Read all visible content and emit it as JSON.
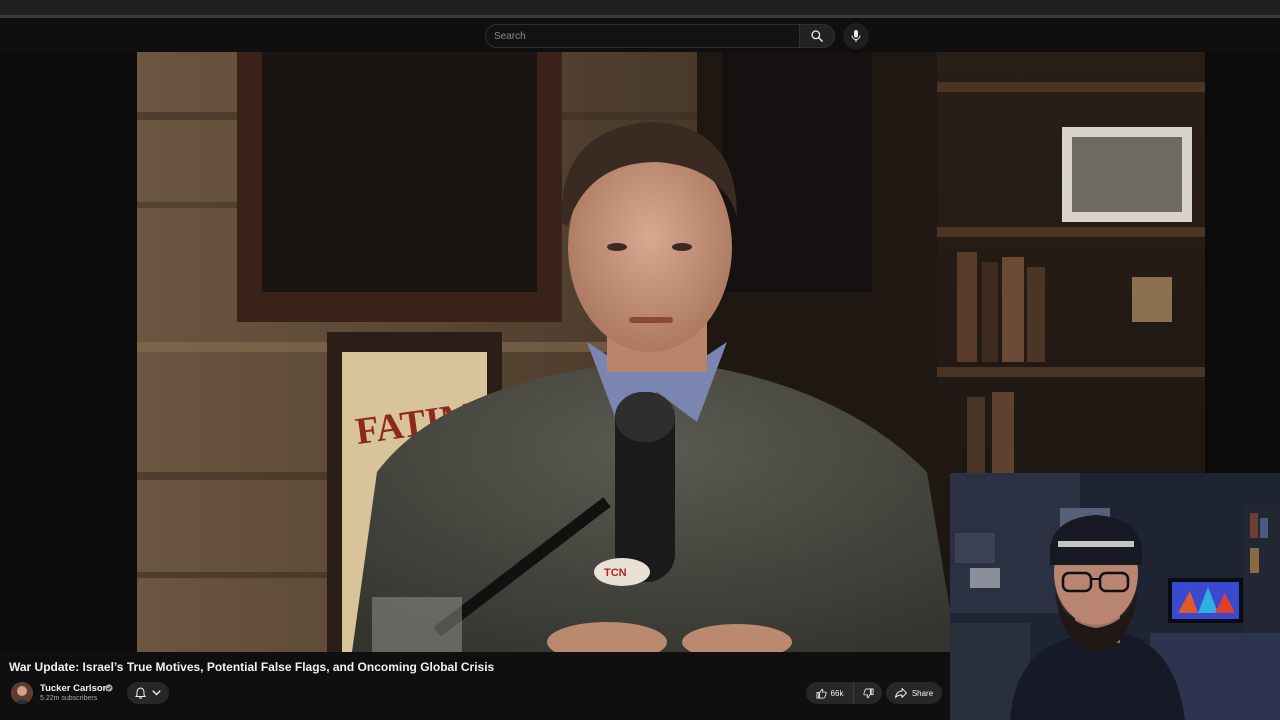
{
  "search": {
    "placeholder": "Search"
  },
  "video": {
    "title": "War Update: Israel’s True Motives, Potential False Flags, and Oncoming Global Crisis",
    "scene_signs": {
      "poster_text": "FATIMA",
      "mic_brand": "TCN"
    }
  },
  "channel": {
    "name": "Tucker Carlson",
    "subscribers": "5.22m subscribers"
  },
  "actions": {
    "like_count": "66k",
    "share_label": "Share"
  },
  "icons": {
    "search": "search-icon",
    "mic": "microphone-icon",
    "verified": "verified-check-icon",
    "bell": "bell-icon",
    "chevron": "chevron-down-icon",
    "like": "thumbs-up-icon",
    "dislike": "thumbs-down-icon",
    "share": "share-arrow-icon"
  },
  "colors": {
    "background": "#0f0f0f",
    "button_bg": "#272727",
    "text_primary": "#f1f1f1",
    "text_secondary": "#aaaaaa"
  }
}
